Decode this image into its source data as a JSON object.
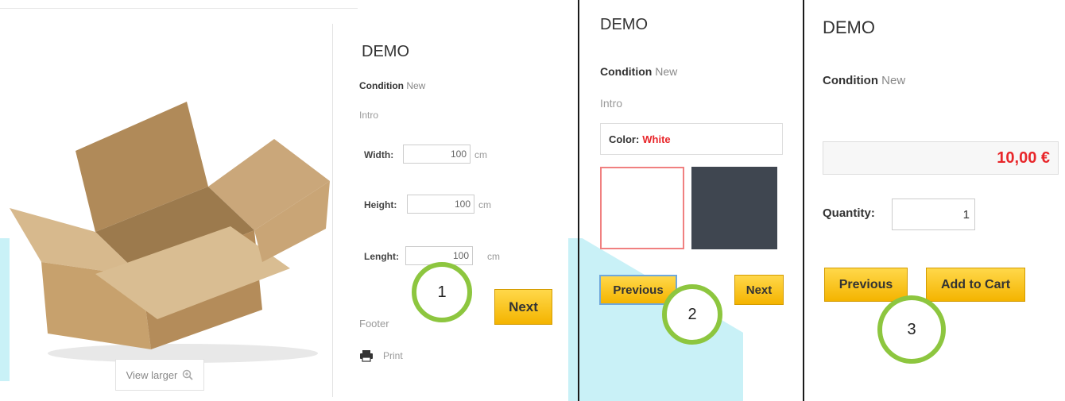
{
  "panel1": {
    "title": "DEMO",
    "condition_label": "Condition",
    "condition_value": "New",
    "intro": "Intro",
    "fields": [
      {
        "label": "Width:",
        "value": "100",
        "unit": "cm"
      },
      {
        "label": "Height:",
        "value": "100",
        "unit": "cm"
      },
      {
        "label": "Lenght:",
        "value": "100",
        "unit": "cm"
      }
    ],
    "next_label": "Next",
    "footer": "Footer",
    "print_label": "Print",
    "view_larger": "View larger",
    "step": "1"
  },
  "panel2": {
    "title": "DEMO",
    "condition_label": "Condition",
    "condition_value": "New",
    "intro": "Intro",
    "color_label": "Color:",
    "color_value": "White",
    "previous_label": "Previous",
    "next_label": "Next",
    "step": "2"
  },
  "panel3": {
    "title": "DEMO",
    "condition_label": "Condition",
    "condition_value": "New",
    "price": "10,00 €",
    "quantity_label": "Quantity:",
    "quantity_value": "1",
    "previous_label": "Previous",
    "add_to_cart_label": "Add to Cart",
    "step": "3"
  },
  "colors": {
    "button_yellow": "#f4b400",
    "step_circle": "#8dc63f",
    "price_red": "#e8262a",
    "swatch_dark": "#3f4650"
  }
}
